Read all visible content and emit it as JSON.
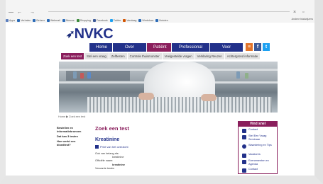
{
  "browser": {
    "apps_label": "Apps",
    "bookmarks": [
      {
        "label": "Verhalen",
        "color": "#2b6bb7"
      },
      {
        "label": "Beheer",
        "color": "#2b6bb7"
      },
      {
        "label": "Webmail",
        "color": "#2b6bb7"
      },
      {
        "label": "Nieuws",
        "color": "#2b6bb7"
      },
      {
        "label": "Shopping",
        "color": "#3a8a3a"
      },
      {
        "label": "Facebook",
        "color": "#3b5998"
      },
      {
        "label": "Twitter",
        "color": "#1da1f2"
      },
      {
        "label": "Vandaag",
        "color": "#d35400"
      },
      {
        "label": "Werkdocs",
        "color": "#2b6bb7"
      },
      {
        "label": "Notulen",
        "color": "#2b6bb7"
      }
    ],
    "other_bookmarks": "Andere bladwijzers"
  },
  "logo": {
    "text": "NVKC"
  },
  "nav": {
    "items": [
      {
        "label": "Home",
        "active": false
      },
      {
        "label": "Over NVKC",
        "active": false
      },
      {
        "label": "Patiënt",
        "active": true
      },
      {
        "label": "Professional",
        "active": false
      },
      {
        "label": "Voor leden",
        "active": false
      }
    ]
  },
  "social": [
    {
      "name": "rss-icon",
      "glyph": "≡",
      "color": "#e2742a"
    },
    {
      "name": "facebook-icon",
      "glyph": "f",
      "color": "#3b5998"
    },
    {
      "name": "twitter-icon",
      "glyph": "t",
      "color": "#1da1f2"
    }
  ],
  "subnav": {
    "items": [
      {
        "label": "Zoek een test",
        "active": true
      },
      {
        "label": "Stel een vraag",
        "active": false
      },
      {
        "label": "Zelftesten",
        "active": false
      },
      {
        "label": "Controle thuismonster",
        "active": false
      },
      {
        "label": "Veelgestelde vragen",
        "active": false
      },
      {
        "label": "Verklaring Reuzen",
        "active": false
      },
      {
        "label": "Achtergrond informatie",
        "active": false
      }
    ]
  },
  "breadcrumb": "Home  ▶  Zoek een test",
  "leftcol": {
    "links": [
      "Bestellen en informatiebronnen",
      "Dat kan 3 testen",
      "Hoe werkt een bloedtest?"
    ]
  },
  "content": {
    "heading": "Zoek een test",
    "test_name": "Kreatinine",
    "print_label": "Print van het overzicht",
    "rows": [
      {
        "label": "Ook van belang als:",
        "value": ""
      },
      {
        "label": "",
        "value": "kreatinine"
      },
      {
        "label": "Officiële naam:",
        "value": ""
      },
      {
        "label": "",
        "value": "kreatinine"
      },
      {
        "label": "Verwante testen",
        "value": ""
      }
    ]
  },
  "vind_snel": {
    "title": "Vind snel",
    "items": [
      {
        "label": "Contact",
        "icon": "person-icon"
      },
      {
        "label": "Stel Een Vraag Seminaar",
        "icon": "question-icon"
      },
      {
        "label": "Waardering en Tips",
        "icon": "star-icon"
      },
      {
        "label": "Vacatures",
        "icon": "briefcase-icon"
      },
      {
        "label": "Evenementen en Agenda",
        "icon": "calendar-icon"
      },
      {
        "label": "Contact",
        "icon": "mail-icon"
      }
    ]
  }
}
